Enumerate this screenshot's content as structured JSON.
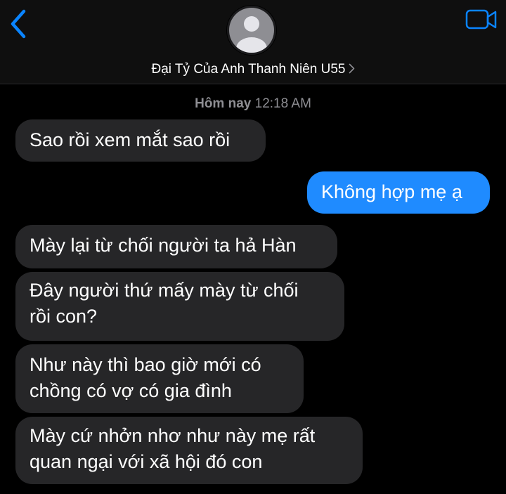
{
  "header": {
    "contact_name": "Đại Tỷ Của Anh Thanh Niên U55",
    "back_icon": "chevron-left-icon",
    "video_icon": "video-camera-icon",
    "avatar_icon": "person-silhouette-icon"
  },
  "thread": {
    "timestamp_day": "Hôm nay",
    "timestamp_time": "12:18 AM"
  },
  "messages": [
    {
      "direction": "incoming",
      "text": "Sao rồi xem mắt sao rồi"
    },
    {
      "direction": "outgoing",
      "text": "Không hợp mẹ ạ"
    },
    {
      "direction": "incoming",
      "text": "Mày lại từ chối người ta hả Hàn"
    },
    {
      "direction": "incoming",
      "lines": [
        "Đây người thứ mấy mày từ chối",
        "rồi con?"
      ]
    },
    {
      "direction": "incoming",
      "lines": [
        "Như này thì bao giờ mới có",
        "chồng có vợ có gia đình"
      ]
    },
    {
      "direction": "incoming",
      "lines": [
        "Mày cứ nhởn nhơ như này mẹ rất",
        "quan ngại với xã hội đó con"
      ]
    }
  ],
  "colors": {
    "background": "#000000",
    "header": "#0f0f0f",
    "incoming_bubble": "#262628",
    "outgoing_bubble": "#1f8bff",
    "accent": "#0a84ff",
    "secondary_text": "#8e8e93"
  }
}
